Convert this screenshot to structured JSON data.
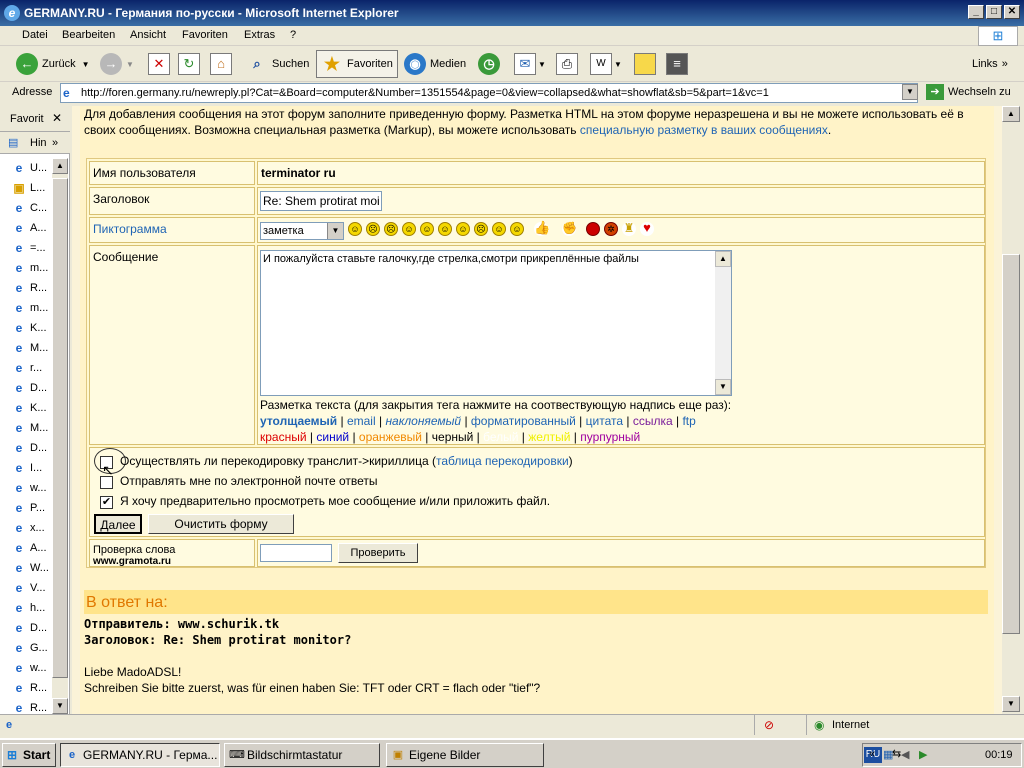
{
  "window": {
    "title": "GERMANY.RU - Германия по-русски - Microsoft Internet Explorer"
  },
  "menu": [
    "Datei",
    "Bearbeiten",
    "Ansicht",
    "Favoriten",
    "Extras",
    "?"
  ],
  "toolbar": {
    "back": "Zurück",
    "search": "Suchen",
    "favorites": "Favoriten",
    "media": "Medien",
    "links": "Links"
  },
  "address": {
    "label": "Adresse",
    "url": "http://foren.germany.ru/newreply.pl?Cat=&Board=computer&Number=1351554&page=0&view=collapsed&what=showflat&sb=5&part=1&vc=1",
    "go": "Wechseln zu"
  },
  "favpanel": {
    "title": "Favorit",
    "history": "Hin",
    "items": [
      "U...",
      "L...",
      "C...",
      "A...",
      "=...",
      "m...",
      "R...",
      "m...",
      "K...",
      "M...",
      "r...",
      "D...",
      "K...",
      "M...",
      "D...",
      "I...",
      "w...",
      "P...",
      "x...",
      "A...",
      "W...",
      "V...",
      "h...",
      "D...",
      "G...",
      "w...",
      "R...",
      "R..."
    ]
  },
  "intro": {
    "text": "Для добавления сообщения на этот форум заполните приведенную форму. Разметка HTML на этом форуме неразрешена и вы не можете использовать её в своих сообщениях. Возможна специальная разметка (Markup), вы можете использовать",
    "link": "специальную разметку в ваших сообщениях",
    "end": "."
  },
  "form": {
    "username_label": "Имя пользователя",
    "username": "terminator ru",
    "subject_label": "Заголовок",
    "subject": "Re: Shem protirat moi",
    "icon_label": "Пиктограмма",
    "icon_select": "заметка",
    "message_label": "Сообщение",
    "message": "И пожалуйста ставьте галочку,где стрелка,смотри прикреплённые файлы",
    "markup_hint": "Разметка текста (для закрытия тега нажмите на соотвествующую надпись еще раз):",
    "markup_row1": [
      "утолщаемый",
      "email",
      "наклоняемый",
      "форматированный",
      "цитата",
      "ссылка",
      "ftp"
    ],
    "markup_row2": [
      "красный",
      "синий",
      "оранжевый",
      "черный",
      "белый",
      "желтый",
      "пурпурный"
    ],
    "cb_translit": "Осуществлять ли перекодировку транслит->кириллица (",
    "cb_translit_link": "таблица перекодировки",
    "cb_translit_end": ")",
    "cb_email": "Отправлять мне по электронной почте ответы",
    "cb_preview": "Я хочу предварительно просмотреть мое сообщение и/или приложить файл.",
    "next_button": "Далее",
    "clear_button": "Очистить форму",
    "spell_label": "Проверка слова",
    "spell_site": "www.gramota.ru",
    "spell_button": "Проверить"
  },
  "reply": {
    "heading": "В ответ на:",
    "sender": "Отправитель: www.schurik.tk",
    "subject": "Заголовок: Re: Shem protirat monitor?",
    "line1": "Liebe MadoADSL!",
    "line2": "Schreiben Sie bitte zuerst, was für einen haben Sie: TFT oder CRT = flach oder \"tief\"?"
  },
  "status": {
    "zone": "Internet"
  },
  "taskbar": {
    "start": "Start",
    "tasks": [
      "GERMANY.RU - Герма...",
      "Bildschirmtastatur",
      "Eigene Bilder"
    ],
    "lang": "RU",
    "clock": "00:19"
  }
}
